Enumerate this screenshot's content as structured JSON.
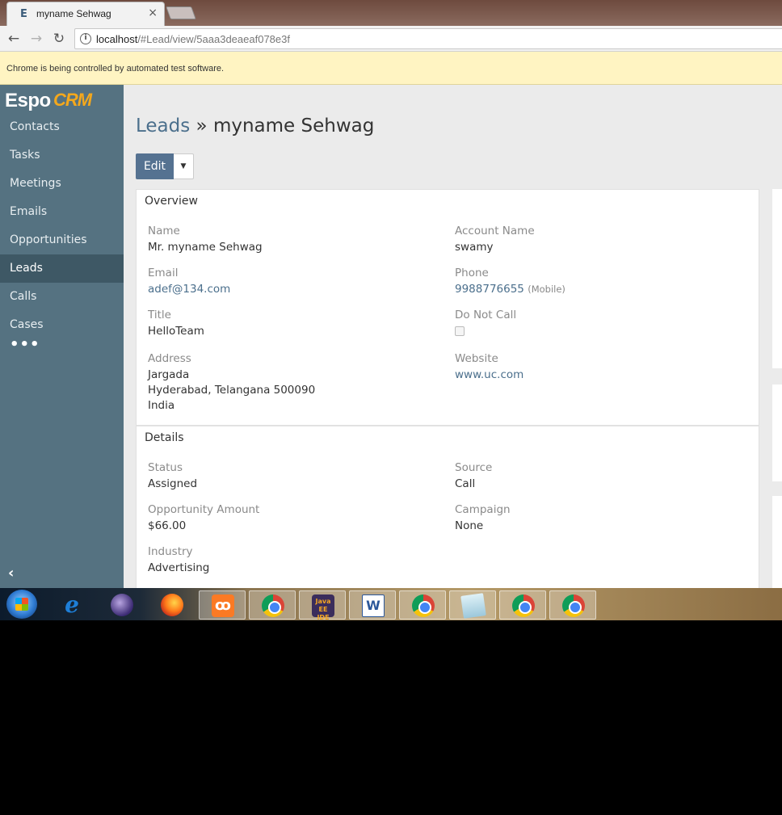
{
  "browser": {
    "tab_title": "myname Sehwag",
    "tab_favicon": "E",
    "close_label": "×",
    "url_host": "localhost",
    "url_path": "/#Lead/view/5aaa3deaeaf078e3f",
    "infobar_text": "Chrome is being controlled by automated test software."
  },
  "app": {
    "logo_espo": "Espo",
    "logo_crm": "CRM",
    "nav": [
      {
        "label": "Contacts",
        "active": false
      },
      {
        "label": "Tasks",
        "active": false
      },
      {
        "label": "Meetings",
        "active": false
      },
      {
        "label": "Emails",
        "active": false
      },
      {
        "label": "Opportunities",
        "active": false
      },
      {
        "label": "Leads",
        "active": true
      },
      {
        "label": "Calls",
        "active": false
      },
      {
        "label": "Cases",
        "active": false
      }
    ],
    "nav_more": "•••",
    "collapse": "‹"
  },
  "record": {
    "breadcrumb": "Leads",
    "separator": " » ",
    "title": "myname Sehwag",
    "edit_label": "Edit",
    "caret": "▼",
    "overview": {
      "title": "Overview",
      "name_label": "Name",
      "name": "Mr. myname Sehwag",
      "account_label": "Account Name",
      "account": "swamy",
      "email_label": "Email",
      "email": "adef@134.com",
      "phone_label": "Phone",
      "phone": "9988776655",
      "phone_type": "(Mobile)",
      "title_label": "Title",
      "title_value": "HelloTeam",
      "dnc_label": "Do Not Call",
      "dnc_checked": false,
      "address_label": "Address",
      "address": "Jargada\nHyderabad, Telangana 500090\nIndia",
      "website_label": "Website",
      "website": "www.uc.com"
    },
    "details": {
      "title": "Details",
      "status_label": "Status",
      "status": "Assigned",
      "source_label": "Source",
      "source": "Call",
      "amount_label": "Opportunity Amount",
      "amount": "$66.00",
      "campaign_label": "Campaign",
      "campaign": "None",
      "industry_label": "Industry",
      "industry": "Advertising"
    }
  },
  "taskbar": {
    "icons": [
      "windows-start-icon",
      "internet-explorer-icon",
      "eclipse-icon",
      "firefox-icon",
      "xampp-icon",
      "chrome-icon",
      "java-ee-ide-icon",
      "word-icon",
      "chrome-icon",
      "notepad-icon",
      "chrome-icon",
      "chrome-icon"
    ],
    "ie_glyph": "e",
    "xampp_glyph": "ꝏ",
    "javaee_text": "Java EE IDE",
    "word_glyph": "W"
  }
}
